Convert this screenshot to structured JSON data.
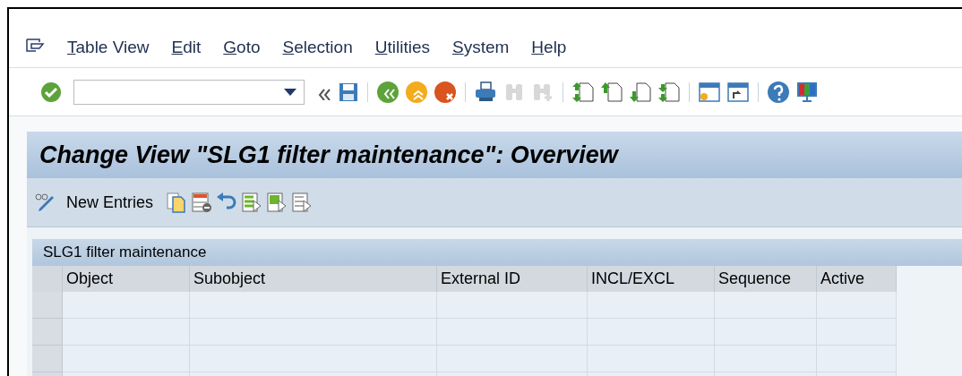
{
  "menu": [
    {
      "label": "Table View"
    },
    {
      "label": "Edit"
    },
    {
      "label": "Goto"
    },
    {
      "label": "Selection"
    },
    {
      "label": "Utilities"
    },
    {
      "label": "System"
    },
    {
      "label": "Help"
    }
  ],
  "toolbar": [
    {
      "kind": "enter",
      "disabled": false
    },
    {
      "kind": "command-field",
      "disabled": false
    },
    {
      "kind": "collapse",
      "disabled": false
    },
    {
      "kind": "save",
      "disabled": false
    },
    {
      "kind": "separator",
      "disabled": false
    },
    {
      "kind": "back",
      "disabled": false
    },
    {
      "kind": "exit",
      "disabled": false
    },
    {
      "kind": "cancel",
      "disabled": false
    },
    {
      "kind": "separator",
      "disabled": false
    },
    {
      "kind": "print",
      "disabled": false
    },
    {
      "kind": "find",
      "disabled": true
    },
    {
      "kind": "find-next",
      "disabled": true
    },
    {
      "kind": "separator",
      "disabled": false
    },
    {
      "kind": "first-page",
      "disabled": false
    },
    {
      "kind": "previous-page",
      "disabled": false
    },
    {
      "kind": "next-page",
      "disabled": false
    },
    {
      "kind": "last-page",
      "disabled": false
    },
    {
      "kind": "separator",
      "disabled": false
    },
    {
      "kind": "new-session",
      "disabled": false
    },
    {
      "kind": "shortcut",
      "disabled": false
    },
    {
      "kind": "separator",
      "disabled": false
    },
    {
      "kind": "help",
      "disabled": false
    },
    {
      "kind": "layout",
      "disabled": false
    }
  ],
  "title": "Change View \"SLG1 filter maintenance\": Overview",
  "app_toolbar": [
    {
      "kind": "display-change"
    },
    {
      "kind": "text",
      "label": "New Entries"
    },
    {
      "kind": "copy"
    },
    {
      "kind": "delete"
    },
    {
      "kind": "undo"
    },
    {
      "kind": "select-all"
    },
    {
      "kind": "select-block"
    },
    {
      "kind": "deselect-all"
    }
  ],
  "table": {
    "title": "SLG1 filter maintenance",
    "columns": [
      "Object",
      "Subobject",
      "External ID",
      "INCL/EXCL",
      "Sequence",
      "Active"
    ]
  }
}
